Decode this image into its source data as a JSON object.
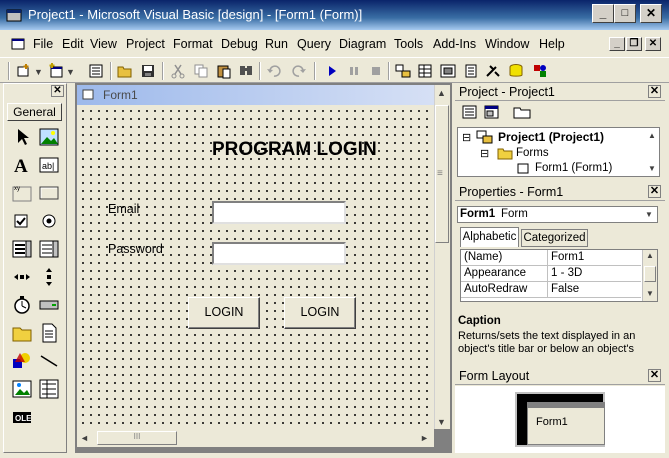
{
  "window": {
    "title": "Project1 - Microsoft Visual Basic [design] - [Form1 (Form)]",
    "controls": {
      "minimize": "_",
      "maximize": "□",
      "close": "✕"
    }
  },
  "menu": {
    "items": [
      "File",
      "Edit",
      "View",
      "Project",
      "Format",
      "Debug",
      "Run",
      "Query",
      "Diagram",
      "Tools",
      "Add-Ins",
      "Window",
      "Help"
    ],
    "mdi_controls": {
      "minimize": "_",
      "restore": "❐",
      "close": "✕"
    }
  },
  "toolbar": {
    "icons": [
      "add-project-icon",
      "add-form-icon",
      "menu-editor-icon",
      "open-icon",
      "save-icon",
      "cut-icon",
      "copy-icon",
      "paste-icon",
      "find-icon",
      "undo-icon",
      "redo-icon",
      "start-icon",
      "break-icon",
      "end-icon",
      "project-explorer-icon",
      "properties-icon",
      "form-layout-icon",
      "object-browser-icon",
      "toolbox-icon",
      "data-view-icon",
      "component-manager-icon"
    ]
  },
  "toolbox": {
    "close": "✕",
    "tab_label": "General",
    "tools": [
      "pointer",
      "picture-box",
      "label",
      "text-box",
      "frame",
      "command-button",
      "check-box",
      "option-button",
      "combo-box",
      "list-box",
      "hscroll-bar",
      "vscroll-bar",
      "timer",
      "drive-list-box",
      "dir-list-box",
      "file-list-box",
      "shape",
      "line",
      "image",
      "data",
      "ole"
    ]
  },
  "designer": {
    "form_caption": "Form1",
    "heading": "PROGRAM LOGIN",
    "email_label": "Email",
    "password_label": "Password",
    "email_value": "",
    "password_value": "",
    "login_button_1": "LOGIN",
    "login_button_2": "LOGIN",
    "hscroll_grip": "III",
    "vscroll_grip": "≡",
    "arrows": {
      "up": "▲",
      "down": "▼",
      "left": "◄",
      "right": "►"
    }
  },
  "project": {
    "title": "Project - Project1",
    "close": "✕",
    "root": "Project1 (Project1)",
    "folder": "Forms",
    "form": "Form1 (Form1)",
    "expander": "⊟"
  },
  "properties": {
    "title": "Properties - Form1",
    "close": "✕",
    "object_name": "Form1",
    "object_type": "Form",
    "tabs": [
      "Alphabetic",
      "Categorized"
    ],
    "rows": [
      {
        "name": "(Name)",
        "value": "Form1"
      },
      {
        "name": "Appearance",
        "value": "1 - 3D"
      },
      {
        "name": "AutoRedraw",
        "value": "False"
      }
    ],
    "description_title": "Caption",
    "description_text": "Returns/sets the text displayed in an object's title bar or below an object's"
  },
  "form_layout": {
    "title": "Form Layout",
    "close": "✕",
    "form_label": "Form1"
  }
}
